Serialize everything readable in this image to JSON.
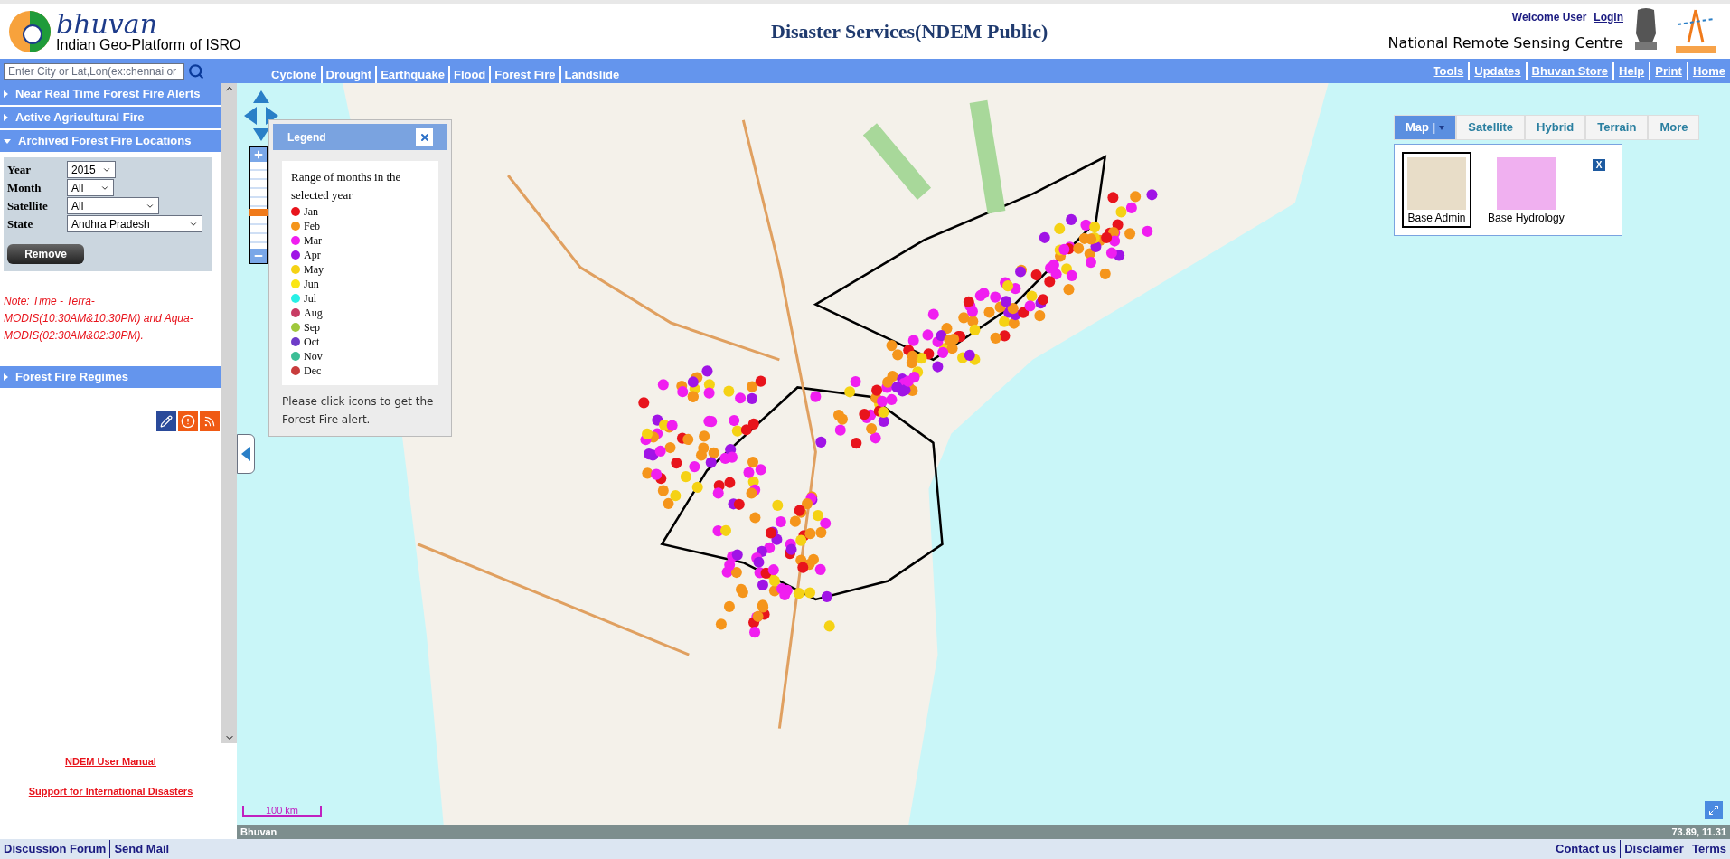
{
  "header": {
    "logo_text": "bhuvan",
    "tagline": "Indian Geo-Platform of ISRO",
    "title": "Disaster Services(NDEM Public)",
    "welcome": "Welcome User",
    "login": "Login",
    "org": "National Remote Sensing Centre"
  },
  "nav": {
    "search_placeholder": "Enter City or Lat,Lon(ex:chennai or",
    "disaster_links": [
      "Cyclone",
      "Drought",
      "Earthquake",
      "Flood",
      "Forest Fire",
      "Landslide"
    ],
    "tool_links": [
      "Tools",
      "Updates",
      "Bhuvan Store",
      "Help",
      "Print",
      "Home"
    ]
  },
  "sidebar": {
    "panels": [
      {
        "label": "Near Real Time Forest Fire Alerts",
        "expanded": false
      },
      {
        "label": "Active Agricultural Fire",
        "expanded": false
      },
      {
        "label": "Archived Forest Fire Locations",
        "expanded": true,
        "fields": [
          {
            "label": "Year",
            "value": "2015"
          },
          {
            "label": "Month",
            "value": "All"
          },
          {
            "label": "Satellite",
            "value": "All"
          },
          {
            "label": "State",
            "value": "Andhra Pradesh"
          }
        ],
        "button": "Remove",
        "note": "Note: Time - Terra-MODIS(10:30AM&10:30PM) and Aqua-MODIS(02:30AM&02:30PM)."
      },
      {
        "label": "Forest Fire Regimes",
        "expanded": false
      }
    ],
    "links": [
      "NDEM User Manual",
      "Support for International Disasters"
    ]
  },
  "legend": {
    "title": "Legend",
    "heading": "Range of months in the selected year",
    "items": [
      {
        "label": "Jan",
        "color": "#e8141c"
      },
      {
        "label": "Feb",
        "color": "#f5951b"
      },
      {
        "label": "Mar",
        "color": "#f01ef0"
      },
      {
        "label": "Apr",
        "color": "#a014e6"
      },
      {
        "label": "May",
        "color": "#f5d214"
      },
      {
        "label": "Jun",
        "color": "#fae614"
      },
      {
        "label": "Jul",
        "color": "#28f0e6"
      },
      {
        "label": "Aug",
        "color": "#c83c64"
      },
      {
        "label": "Sep",
        "color": "#a0c83c"
      },
      {
        "label": "Oct",
        "color": "#6e3cc8"
      },
      {
        "label": "Nov",
        "color": "#3cbe96"
      },
      {
        "label": "Dec",
        "color": "#c83c3c"
      }
    ],
    "hint": "Please click icons to get the Forest Fire alert."
  },
  "map_types": [
    {
      "label": "Map |",
      "selected": true
    },
    {
      "label": "Satellite",
      "selected": false
    },
    {
      "label": "Hybrid",
      "selected": false
    },
    {
      "label": "Terrain",
      "selected": false
    },
    {
      "label": "More",
      "selected": false
    }
  ],
  "base_layers": {
    "close_label": "X",
    "items": [
      {
        "label": "Base Admin",
        "selected": true
      },
      {
        "label": "Base Hydrology",
        "selected": false
      }
    ]
  },
  "zoom": {
    "level": 0.42
  },
  "scale": "100 km",
  "status_bar": {
    "left": "Bhuvan",
    "coords": "73.89, 11.31"
  },
  "footer": {
    "left_links": [
      "Discussion Forum",
      "Send Mail"
    ],
    "right_links": [
      "Contact us",
      "Disclaimer",
      "Terms"
    ]
  }
}
